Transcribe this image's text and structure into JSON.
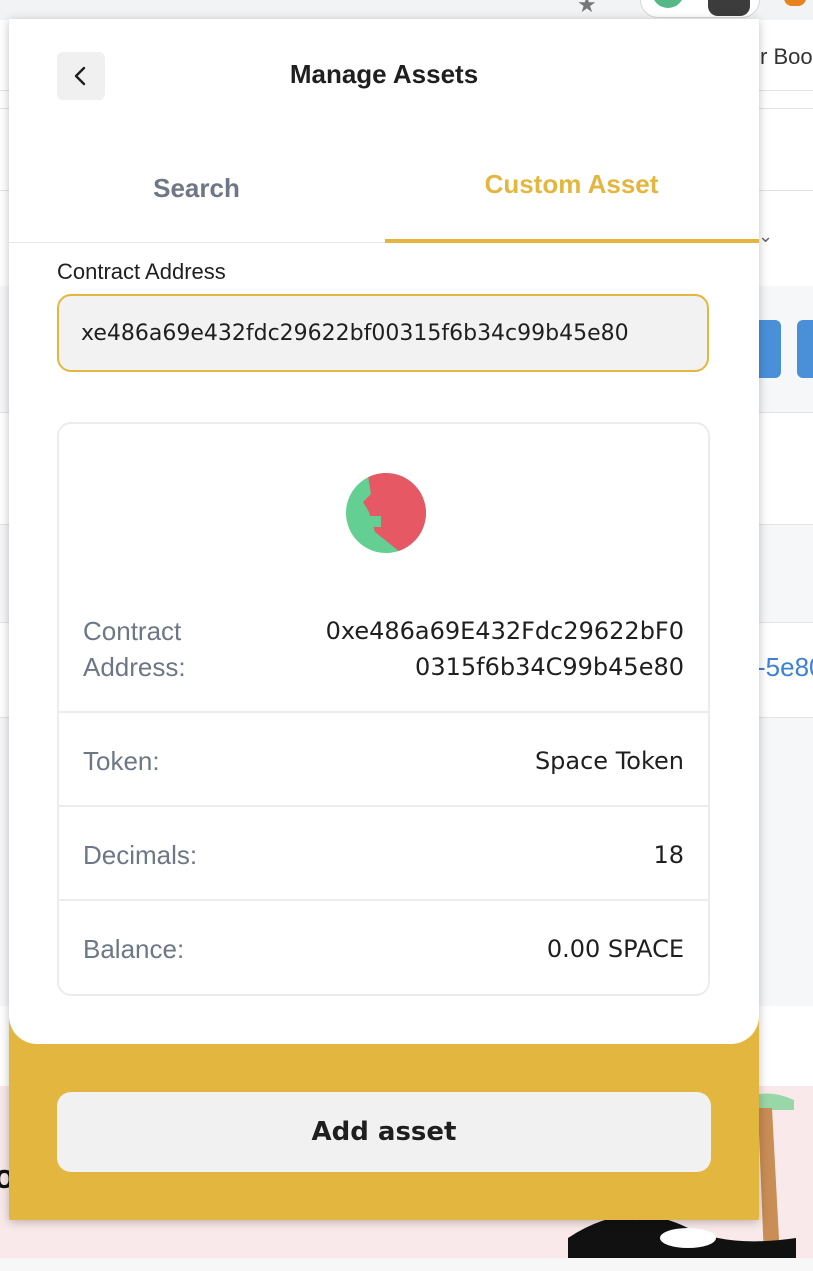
{
  "background": {
    "bookmark_fragment": "r Boo",
    "link_fragment": "-5e80"
  },
  "header": {
    "title": "Manage Assets"
  },
  "tabs": [
    {
      "label": "Search",
      "active": false
    },
    {
      "label": "Custom Asset",
      "active": true
    }
  ],
  "form": {
    "contract_label": "Contract Address",
    "contract_value": "xe486a69e432fdc29622bf00315f6b34c99b45e80"
  },
  "token_card": {
    "contract_label_line1": "Contract",
    "contract_label_line2": "Address:",
    "contract_value_line1": "0xe486a69E432Fdc29622bF0",
    "contract_value_line2": "0315f6b34C99b45e80",
    "token_label": "Token:",
    "token_value": "Space Token",
    "decimals_label": "Decimals:",
    "decimals_value": "18",
    "balance_label": "Balance:",
    "balance_value": "0.00 SPACE"
  },
  "actions": {
    "add_label": "Add asset"
  },
  "colors": {
    "accent": "#e3b73f",
    "token_red": "#e65864",
    "token_green": "#63cf92"
  }
}
